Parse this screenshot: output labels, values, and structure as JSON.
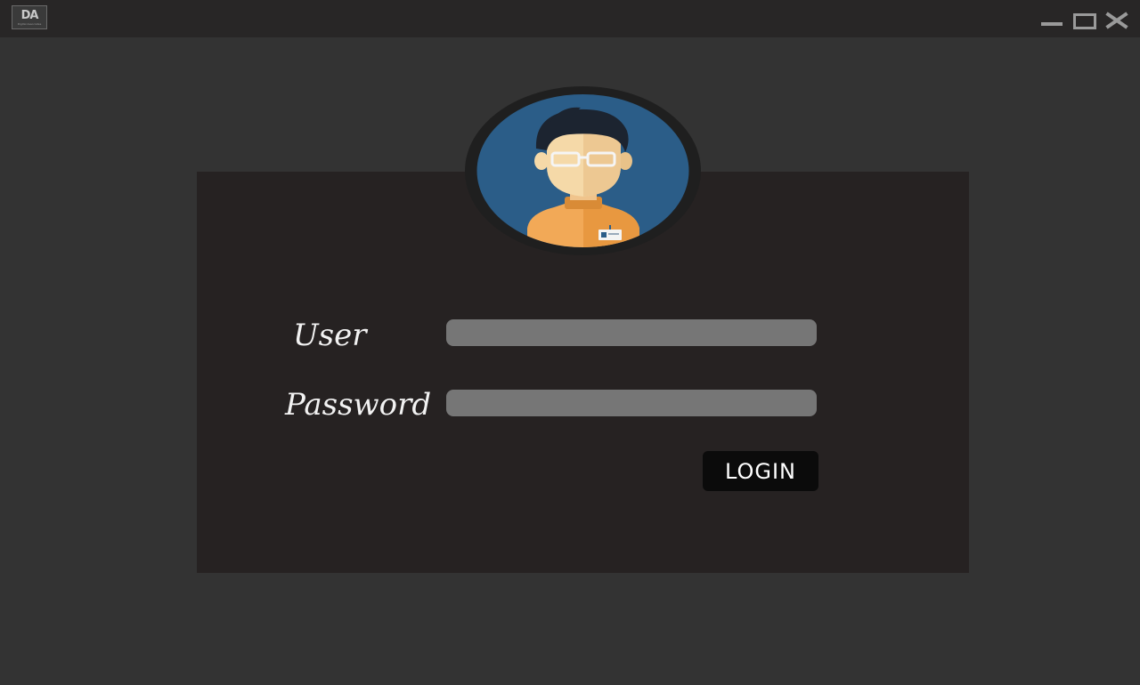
{
  "window": {
    "logo_text": "DA",
    "logo_subtext": "Digital Associates",
    "controls": [
      "minimize-icon",
      "maximize-icon",
      "close-icon"
    ]
  },
  "login": {
    "user_label": "User",
    "password_label": "Password",
    "user_value": "",
    "password_value": "",
    "button_label": "LOGIN"
  },
  "colors": {
    "background": "#333333",
    "titlebar": "#282626",
    "panel": "#262222",
    "field": "#767676",
    "button": "#0b0b0b",
    "avatar_bg": "#2b5d88",
    "avatar_skin": "#f5d9a8",
    "avatar_shirt": "#f2a957"
  }
}
